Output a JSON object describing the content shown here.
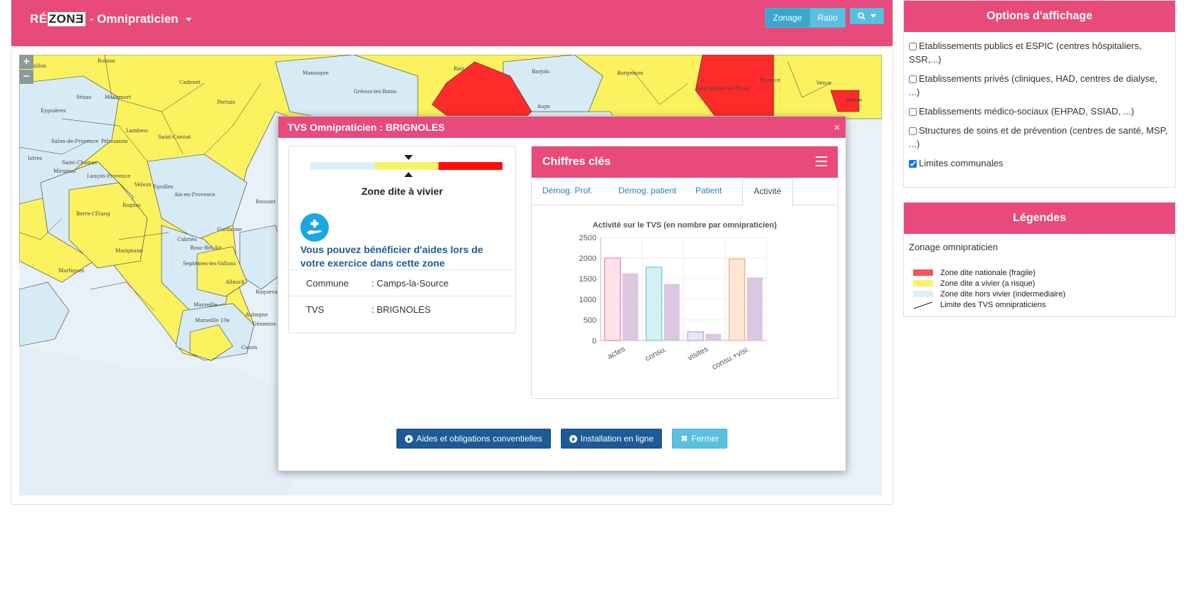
{
  "app": {
    "brand_prefix": "RÉ",
    "brand_zone": "ZON",
    "brand_suffix": "Ǝ",
    "module": "- Omnipraticien"
  },
  "toolbar": {
    "zonage_label": "Zonage",
    "ratio_label": "Ratio",
    "search_icon": "search-icon"
  },
  "map": {
    "labels": [
      "Cavaillon",
      "Robion",
      "Cadenet",
      "Pertuis",
      "Manosque",
      "Gréoux-les-Bains",
      "Riez",
      "Barjols",
      "Aups",
      "Bargemon",
      "Fayence",
      "Saint-Vallier-de-Thiey",
      "Vence",
      "Grasse",
      "Sénas",
      "Mallemort",
      "Eyguières",
      "Lambesc",
      "Saint-Cannat",
      "Salon-de-Provence",
      "Pélissanne",
      "Istres",
      "Saint-Chamas",
      "Lançon-Provence",
      "Velaux",
      "Aix-en-Provence",
      "Miramas",
      "Berre-l'Étang",
      "Rognac",
      "Éguilles",
      "Gardanne",
      "Martigues",
      "Marignane",
      "Cabriès",
      "Bouc-Bel-Air",
      "Septèmes-les-Vallons",
      "Allauch",
      "Marseille",
      "Marseille 10e",
      "Aubagne",
      "Cassis",
      "Roquevaire",
      "Rousset",
      "Gémenos"
    ]
  },
  "modal": {
    "title": "TVS Omnipraticien : BRIGNOLES",
    "close": "×",
    "zone_title": "Zone dite à vivier",
    "aid_text": "Vous pouvez bénéficier d'aides lors de votre exercice dans cette zone",
    "info": [
      {
        "key": "Commune",
        "value": ": Camps-la-Source"
      },
      {
        "key": "TVS",
        "value": ": BRIGNOLES"
      }
    ],
    "buttons": {
      "aides": "Aides et obligations conventielles",
      "installation": "Installation en ligne",
      "fermer": "Fermer"
    }
  },
  "chiffres": {
    "title": "Chiffres clés",
    "tabs": [
      "Démog. Prof.",
      "Démog. patient",
      "Patient",
      "Activité"
    ],
    "active_tab": "Activité"
  },
  "chart_data": {
    "type": "bar",
    "title": "Activité sur le TVS (en nombre par omnipraticien)",
    "categories": [
      "actes",
      "consu.",
      "visites",
      "consu.+visi."
    ],
    "series": [
      {
        "values": [
          2000,
          1780,
          210,
          1980
        ]
      },
      {
        "values": [
          1630,
          1370,
          160,
          1530
        ]
      }
    ],
    "colors": {
      "first_series_fill": [
        "#fde2ea",
        "#d6f1f3",
        "#ece7f7",
        "#fde6d3"
      ],
      "first_series_stroke": [
        "#f06a92",
        "#4fbfcc",
        "#a08fd6",
        "#f3a05a"
      ],
      "second_series_fill": "#dcc6e2"
    },
    "ylim": [
      0,
      2500
    ],
    "yticks": [
      0,
      500,
      1000,
      1500,
      2000,
      2500
    ],
    "grid": true
  },
  "options": {
    "title": "Options d'affichage",
    "items": [
      {
        "label": "Etablissements publics et ESPIC (centres hôspitaliers, SSR,...)",
        "checked": false
      },
      {
        "label": "Etablissements privés (cliniques, HAD, centres de dialyse, ...)",
        "checked": false
      },
      {
        "label": "Etablissements médico-sociaux (EHPAD, SSIAD, ...)",
        "checked": false
      },
      {
        "label": "Structures de soins et de prévention (centres de santé, MSP, ...)",
        "checked": false
      },
      {
        "label": "Limites communales",
        "checked": true
      }
    ]
  },
  "legend": {
    "title": "Légendes",
    "subtitle": "Zonage omnipraticien",
    "items": [
      {
        "label": "Zone dite nationale (fragile)",
        "color": "#f2545b"
      },
      {
        "label": "Zone dite a vivier (a risque)",
        "color": "#f7f36b"
      },
      {
        "label": "Zone dite hors vivier (indermediaire)",
        "color": "#ddeef9"
      },
      {
        "label": "Limite des TVS omnipraticiens",
        "color": "#222222"
      }
    ]
  },
  "colors": {
    "brand": "#e84a7b",
    "zone_fragile": "#ff1a1a",
    "zone_vivier": "#ffed5c",
    "zone_hors_vivier": "#d8ecf7"
  }
}
